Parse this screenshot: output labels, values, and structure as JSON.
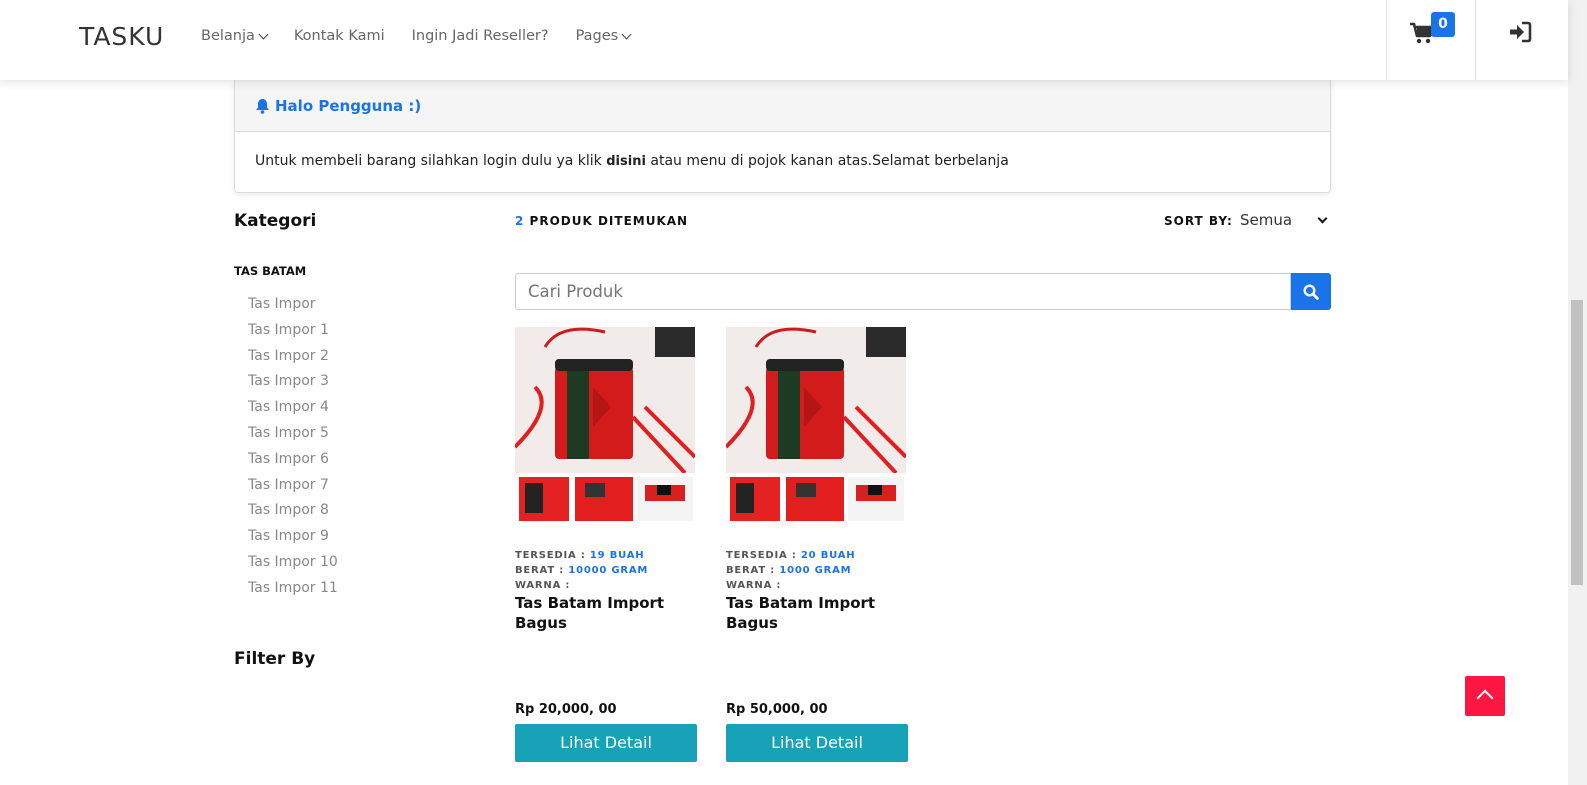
{
  "header": {
    "brand": "TASKU",
    "nav": [
      {
        "label": "Belanja",
        "dropdown": true
      },
      {
        "label": "Kontak Kami",
        "dropdown": false
      },
      {
        "label": "Ingin Jadi Reseller?",
        "dropdown": false
      },
      {
        "label": "Pages",
        "dropdown": true
      }
    ],
    "cart_count": "0",
    "accent": "#1a73e8"
  },
  "alert": {
    "title": "Halo Pengguna :)",
    "text_before": "Untuk membeli barang silahkan login dulu ya klik ",
    "link": "disini",
    "text_after": " atau menu di pojok kanan atas.Selamat berbelanja"
  },
  "sidebar": {
    "title": "Kategori",
    "category": "TAS BATAM",
    "items": [
      "Tas Impor",
      "Tas Impor 1",
      "Tas Impor 2",
      "Tas Impor 3",
      "Tas Impor 4",
      "Tas Impor 5",
      "Tas Impor 6",
      "Tas Impor 7",
      "Tas Impor 8",
      "Tas Impor 9",
      "Tas Impor 10",
      "Tas Impor 11"
    ],
    "filter_title": "Filter By"
  },
  "results": {
    "count": "2",
    "label": " PRODUK DITEMUKAN",
    "sort_label": "SORT BY:",
    "sort_value": "Semua"
  },
  "search": {
    "placeholder": "Cari Produk"
  },
  "products": [
    {
      "stock_label": "TERSEDIA : ",
      "stock": "19 BUAH",
      "weight_label": "BERAT : ",
      "weight": "10000 GRAM",
      "color_label": "WARNA :",
      "name": "Tas Batam Import Bagus",
      "price": "Rp 20,000, 00",
      "button": "Lihat Detail"
    },
    {
      "stock_label": "TERSEDIA : ",
      "stock": "20 BUAH",
      "weight_label": "BERAT : ",
      "weight": "1000 GRAM",
      "color_label": "WARNA :",
      "name": "Tas Batam Import Bagus",
      "price": "Rp 50,000, 00",
      "button": "Lihat Detail"
    }
  ]
}
